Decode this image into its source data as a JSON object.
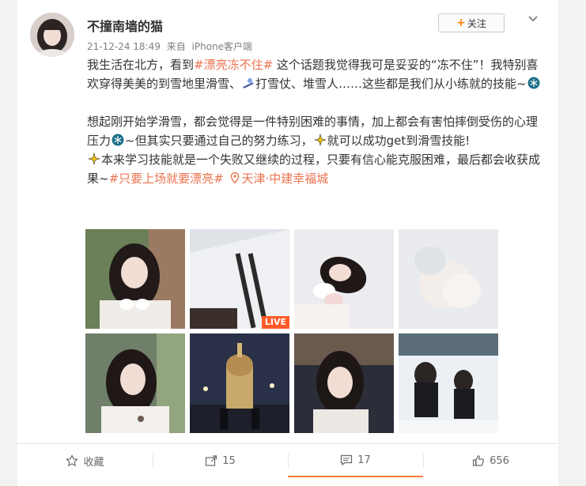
{
  "post": {
    "username": "不撞南墙的猫",
    "time": "21-12-24 18:49",
    "source_prefix": "来自",
    "source": "iPhone客户端",
    "follow_label": "关注",
    "para1": {
      "t1": "我生活在北方，看到",
      "tag1": "#漂亮冻不住#",
      "t2": " 这个话题我觉得我可是妥妥的“冻不住”！我特别喜欢穿得美美的到雪地里滑雪、",
      "t3": "打雪仗、堆雪人……这些都是我们从小练就的技能~"
    },
    "para2": {
      "t1": "想起刚开始学滑雪，都会觉得是一件特别困难的事情，加上都会有害怕摔倒受伤的心理压力",
      "t2": "~但其实只要通过自己的努力练习，",
      "t3": "就可以成功get到滑雪技能!",
      "t4": "本来学习技能就是一个失败又继续的过程，只要有信心能克服困难，最后都会收获成果~",
      "tag2": "#只要上场就要漂亮#",
      "location": "天津·中建幸福城"
    },
    "live_badge": "LIVE"
  },
  "actions": {
    "favorite": "收藏",
    "repost": "15",
    "comment": "17",
    "like": "656"
  },
  "colors": {
    "accent": "#eb7350",
    "follow_plus": "#ff8200",
    "live": "#ff5a2a"
  },
  "icons": [
    "chevron-down-icon",
    "snowflake-icon",
    "ski-icon",
    "sparkle-icon",
    "location-pin-icon",
    "star-icon",
    "repost-icon",
    "comment-icon",
    "like-icon"
  ]
}
